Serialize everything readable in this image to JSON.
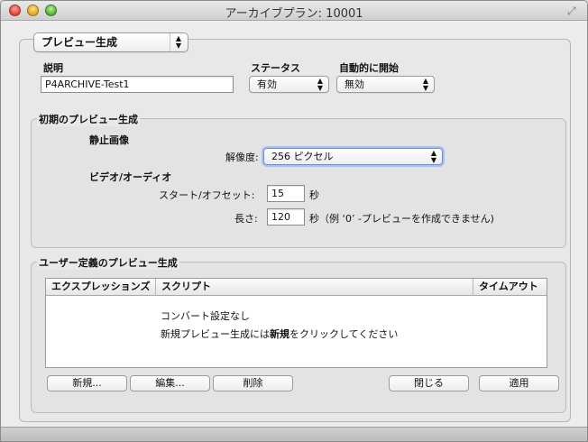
{
  "window": {
    "title": "アーカイブプラン: 10001"
  },
  "top_popup": {
    "value": "プレビュー生成"
  },
  "general": {
    "description_label": "説明",
    "description_value": "P4ARCHIVE-Test1",
    "status_label": "ステータス",
    "status_value": "有効",
    "autostart_label": "自動的に開始",
    "autostart_value": "無効"
  },
  "initial_preview": {
    "group_title": "初期のプレビュー生成",
    "still_image_label": "静止画像",
    "resolution_label": "解像度:",
    "resolution_value": "256 ピクセル",
    "video_audio_label": "ビデオ/オーディオ",
    "start_offset_label": "スタート/オフセット:",
    "start_offset_value": "15",
    "start_offset_unit": "秒",
    "length_label": "長さ:",
    "length_value": "120",
    "length_unit": "秒（例 ‘0’ -プレビューを作成できません)"
  },
  "user_preview": {
    "group_title": "ユーザー定義のプレビュー生成",
    "columns": [
      "エクスプレッションズ",
      "スクリプト",
      "タイムアウト"
    ],
    "empty_line1": "コンバート設定なし",
    "empty_line2_pre": "新規プレビュー生成には",
    "empty_line2_bold": "新規",
    "empty_line2_post": "をクリックしてください",
    "buttons": {
      "new": "新規...",
      "edit": "編集...",
      "delete": "削除",
      "close": "閉じる",
      "apply": "適用"
    }
  }
}
